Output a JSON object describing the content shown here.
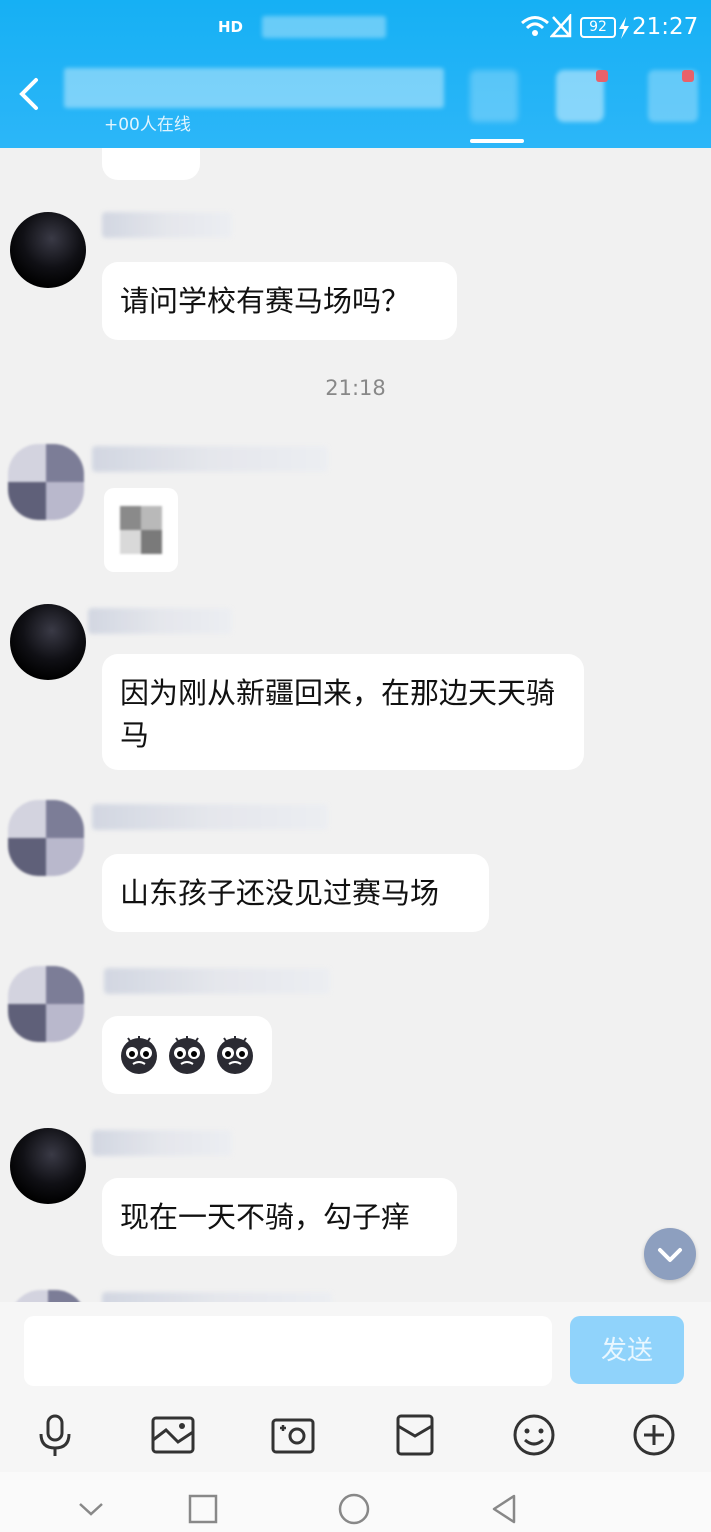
{
  "status_bar": {
    "hd_label": "HD",
    "battery": "92",
    "time": "21:27"
  },
  "header": {
    "online_text": "+00人在线"
  },
  "chat": {
    "timestamp": "21:18",
    "messages": [
      {
        "text": "请问学校有赛马场吗？"
      },
      {
        "text": "因为刚从新疆回来，在那边天天骑马"
      },
      {
        "text": "山东孩子还没见过赛马场"
      },
      {
        "text": "现在一天不骑，勾子痒"
      }
    ],
    "emoji_message": {
      "text": "😟😟😟"
    }
  },
  "input": {
    "placeholder": "",
    "send_label": "发送"
  },
  "icons": {
    "back": "back-arrow-icon",
    "toolbar": [
      "microphone-icon",
      "image-icon",
      "camera-icon",
      "red-packet-icon",
      "emoji-icon",
      "plus-icon"
    ],
    "navbar": [
      "chevron-down-icon",
      "recent-apps-icon",
      "home-icon",
      "back-triangle-icon"
    ]
  },
  "colors": {
    "header": "#16b0f4",
    "send_button": "#90d3fb",
    "chat_bg": "#f1f1f1"
  }
}
